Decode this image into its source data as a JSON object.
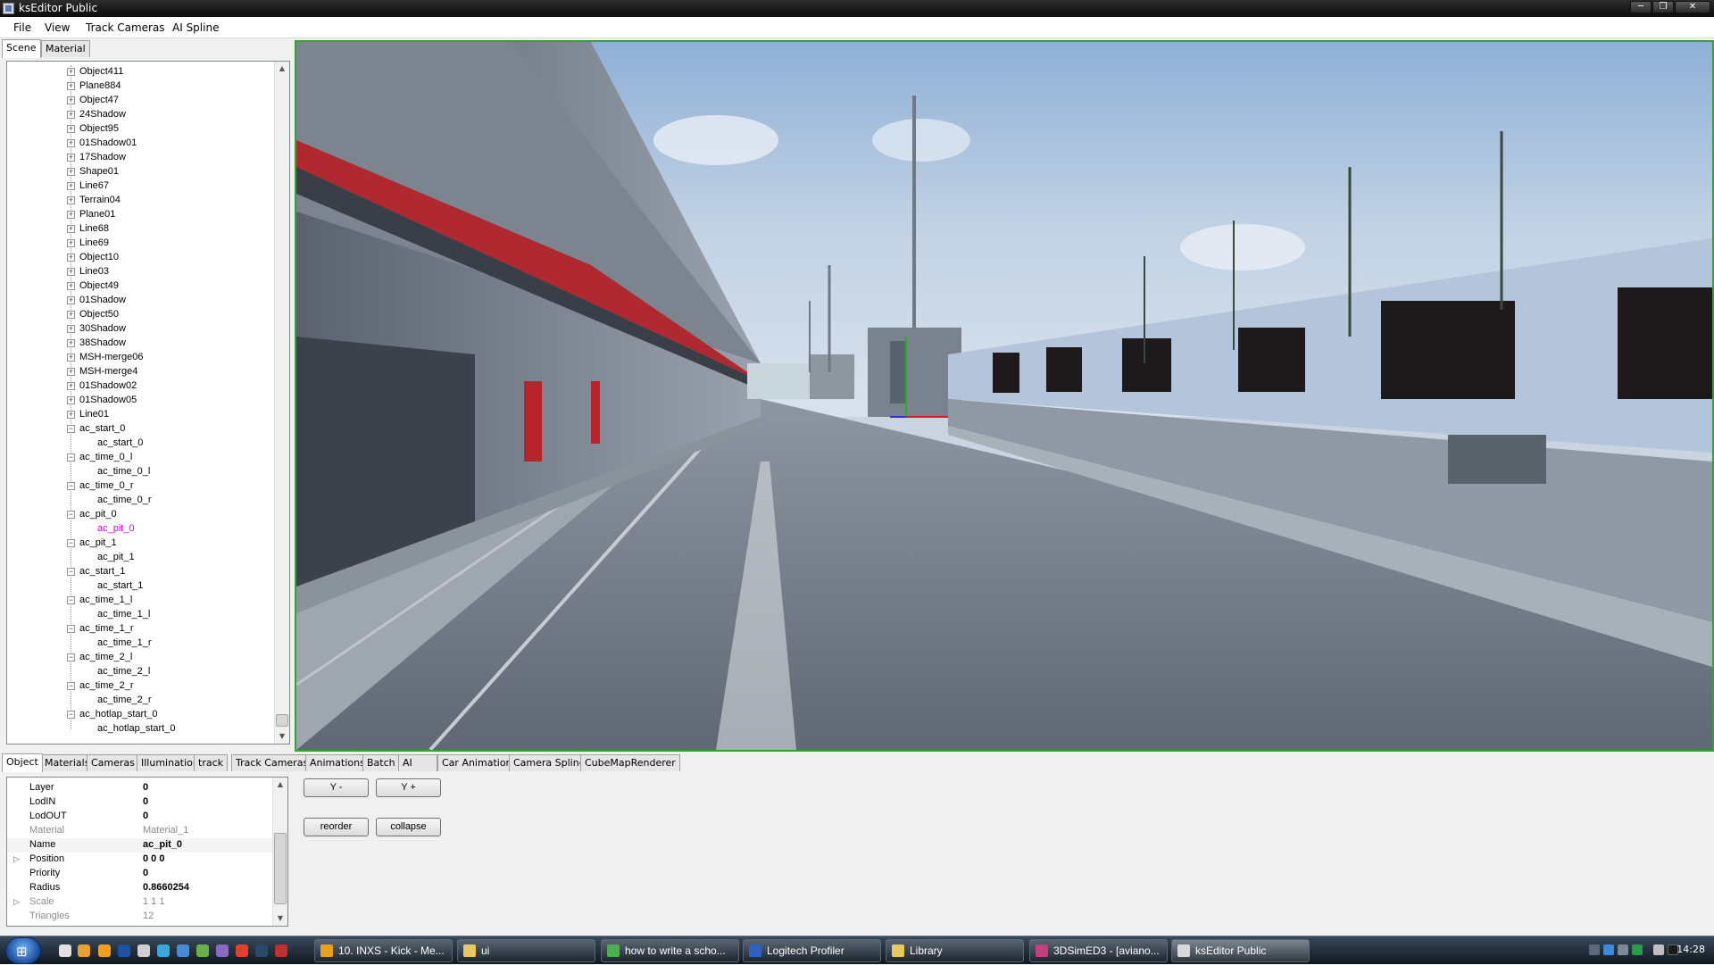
{
  "window": {
    "title": "ksEditor Public",
    "buttons": [
      "─",
      "❐",
      "✕"
    ]
  },
  "menu": [
    "File",
    "View",
    "Track Cameras",
    "AI Spline"
  ],
  "top_tabs": [
    "Scene",
    "Material"
  ],
  "tree": {
    "collapsed_nodes": [
      "Object411",
      "Plane884",
      "Object47",
      "24Shadow",
      "Object95",
      "01Shadow01",
      "17Shadow",
      "Shape01",
      "Line67",
      "Terrain04",
      "Plane01",
      "Line68",
      "Line69",
      "Object10",
      "Line03",
      "Object49",
      "01Shadow",
      "Object50",
      "30Shadow",
      "38Shadow",
      "MSH-merge06",
      "MSH-merge4",
      "01Shadow02",
      "01Shadow05",
      "Line01"
    ],
    "expanded_nodes": [
      {
        "label": "ac_start_0",
        "child": "ac_start_0"
      },
      {
        "label": "ac_time_0_l",
        "child": "ac_time_0_l"
      },
      {
        "label": "ac_time_0_r",
        "child": "ac_time_0_r"
      },
      {
        "label": "ac_pit_0",
        "child": "ac_pit_0",
        "selected": true
      },
      {
        "label": "ac_pit_1",
        "child": "ac_pit_1"
      },
      {
        "label": "ac_start_1",
        "child": "ac_start_1"
      },
      {
        "label": "ac_time_1_l",
        "child": "ac_time_1_l"
      },
      {
        "label": "ac_time_1_r",
        "child": "ac_time_1_r"
      },
      {
        "label": "ac_time_2_l",
        "child": "ac_time_2_l"
      },
      {
        "label": "ac_time_2_r",
        "child": "ac_time_2_r"
      },
      {
        "label": "ac_hotlap_start_0",
        "child": "ac_hotlap_start_0"
      }
    ],
    "expand_glyph": "+",
    "collapse_glyph": "−"
  },
  "bottom_tabs": [
    "Object",
    "Materials",
    "Cameras",
    "Illumination",
    "track",
    "Track Cameras",
    "Animations",
    "Batch",
    "AI",
    "Car Animations",
    "Camera Spline",
    "CubeMapRenderer"
  ],
  "properties": [
    {
      "key": "Layer",
      "value": "0"
    },
    {
      "key": "LodIN",
      "value": "0"
    },
    {
      "key": "LodOUT",
      "value": "0"
    },
    {
      "key": "Material",
      "value": "Material_1",
      "dim": true
    },
    {
      "key": "Name",
      "value": "ac_pit_0"
    },
    {
      "key": "Position",
      "value": "0 0 0",
      "expandable": true
    },
    {
      "key": "Priority",
      "value": "0"
    },
    {
      "key": "Radius",
      "value": "0.8660254"
    },
    {
      "key": "Scale",
      "value": "1 1 1",
      "dim": true,
      "expandable": true
    },
    {
      "key": "Triangles",
      "value": "12",
      "dim": true
    }
  ],
  "buttons": {
    "y_minus": "Y -",
    "y_plus": "Y +",
    "reorder": "reorder",
    "collapse": "collapse"
  },
  "taskbar": {
    "items": [
      {
        "label": "10. INXS - Kick - Me...",
        "color": "#e8a020"
      },
      {
        "label": "ui",
        "color": "#e8c860"
      },
      {
        "label": "how to write a scho...",
        "color": "#4caf50"
      },
      {
        "label": "Logitech Profiler",
        "color": "#3060c0"
      },
      {
        "label": "Library",
        "color": "#e8c860"
      },
      {
        "label": "3DSimED3 - [aviano...",
        "color": "#c04080"
      },
      {
        "label": "ksEditor Public",
        "color": "#d9d9d9",
        "active": true
      }
    ],
    "clock": "14:28"
  }
}
